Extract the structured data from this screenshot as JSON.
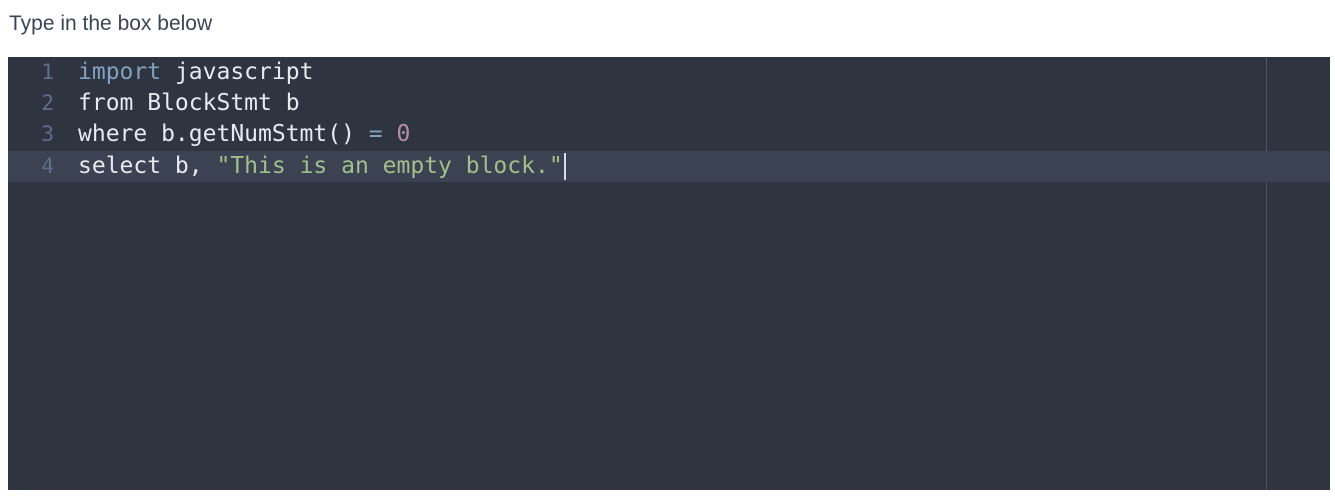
{
  "instruction": "Type in the box below",
  "editor": {
    "lines": [
      {
        "number": "1",
        "keyword": "import",
        "rest": " javascript"
      },
      {
        "number": "2",
        "text": "from BlockStmt b"
      },
      {
        "number": "3",
        "text": "where b.getNumStmt() ",
        "operator": "=",
        "space": " ",
        "number_literal": "0"
      },
      {
        "number": "4",
        "text": "select b, ",
        "string_literal": "\"This is an empty block.\""
      }
    ],
    "active_line": 4,
    "colors": {
      "background": "#2e3440",
      "active_line": "#3b4252",
      "keyword": "#81a1c1",
      "number": "#b48ead",
      "string": "#a3be8c",
      "text": "#e5e9f0",
      "gutter": "#616e88"
    }
  }
}
